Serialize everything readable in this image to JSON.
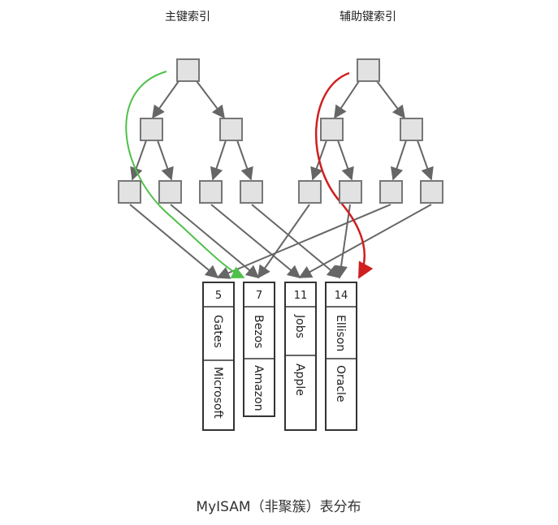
{
  "titles": {
    "primary": "主键索引",
    "secondary": "辅助键索引"
  },
  "caption": "MyISAM（非聚簇）表分布",
  "colors": {
    "node_fill": "#e2e2e2",
    "node_stroke": "#777777",
    "line": "#666666",
    "green": "#4fc14a",
    "red": "#cf1f1f"
  },
  "records": [
    {
      "id": "5",
      "name": "Gates",
      "company": "Microsoft"
    },
    {
      "id": "7",
      "name": "Bezos",
      "company": "Amazon"
    },
    {
      "id": "11",
      "name": "Jobs",
      "company": "Apple"
    },
    {
      "id": "14",
      "name": "Ellison",
      "company": "Oracle"
    }
  ]
}
